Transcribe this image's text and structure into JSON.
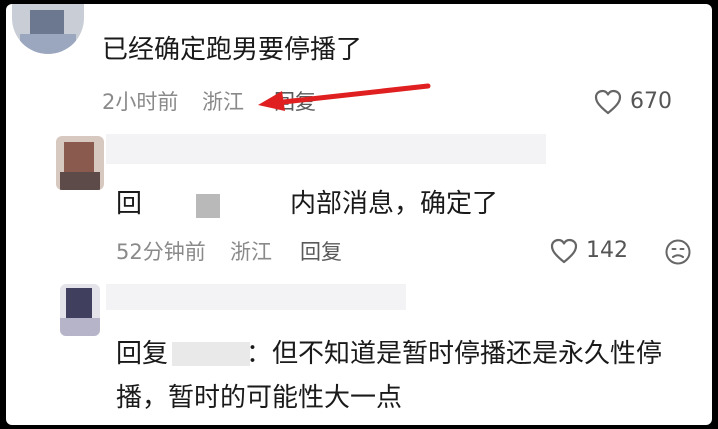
{
  "comments": [
    {
      "text": "已经确定跑男要停播了",
      "time": "2小时前",
      "location": "浙江",
      "reply_label": "回复",
      "like_count": "670"
    },
    {
      "reply_prefix": "回",
      "text": "内部消息，确定了",
      "time": "52分钟前",
      "location": "浙江",
      "reply_label": "回复",
      "like_count": "142"
    },
    {
      "reply_prefix": "回复",
      "text_line1": "：但不知道是暂时停播还是永久性停",
      "text_line2": "播，暂时的可能性大一点"
    }
  ],
  "icons": {
    "like": "heart-outline-icon",
    "dislike": "frown-face-icon",
    "annotation": "red-arrow"
  },
  "colors": {
    "arrow": "#e02020",
    "meta_text": "#8a8a8a",
    "body_text": "#1a1a1a"
  }
}
